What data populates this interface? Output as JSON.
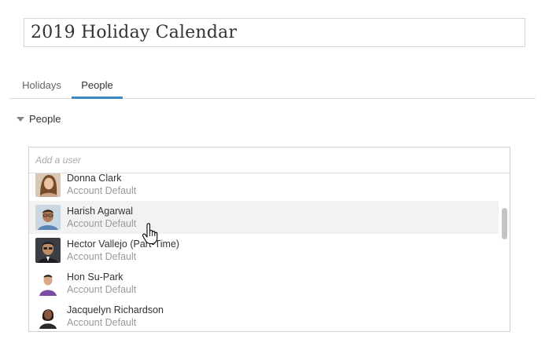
{
  "title": "2019 Holiday Calendar",
  "tabs": [
    {
      "label": "Holidays",
      "active": false
    },
    {
      "label": "People",
      "active": true
    }
  ],
  "section": {
    "label": "People",
    "expanded": true
  },
  "add_user": {
    "placeholder": "Add a user",
    "value": ""
  },
  "users": [
    {
      "name": "Donna Clark",
      "setting": "Account Default",
      "avatar": "avatar-photo"
    },
    {
      "name": "Harish Agarwal",
      "setting": "Account Default",
      "avatar": "avatar-photo",
      "hovered": true
    },
    {
      "name": "Hector Vallejo (Part-Time)",
      "setting": "Account Default",
      "avatar": "avatar-photo"
    },
    {
      "name": "Hon Su-Park",
      "setting": "Account Default",
      "avatar": "avatar-photo"
    },
    {
      "name": "Jacquelyn Richardson",
      "setting": "Account Default",
      "avatar": "avatar-photo"
    }
  ],
  "colors": {
    "accent": "#3b87c8",
    "hover_row": "#f2f2f0",
    "muted_text": "#9a9a9a"
  }
}
